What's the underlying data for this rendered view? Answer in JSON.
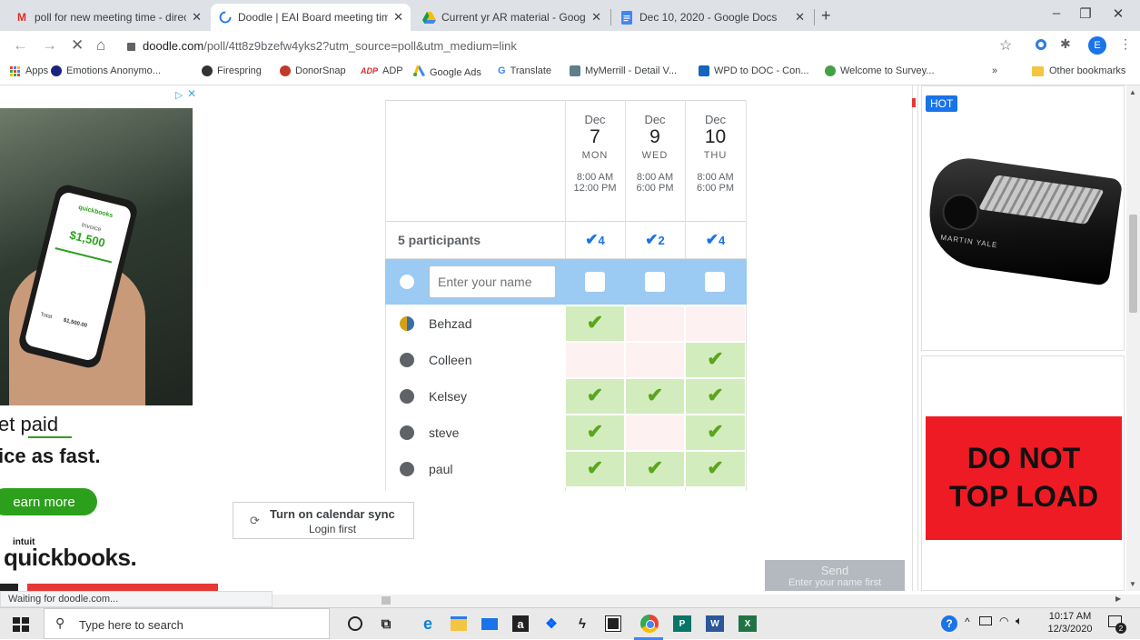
{
  "browser": {
    "tabs": [
      {
        "title": "poll for new meeting time - direc",
        "favicon": "M",
        "favicon_color": "#d93025",
        "active": false
      },
      {
        "title": "Doodle | EAI Board meeting time",
        "favicon": "○",
        "favicon_color": "#1a73e8",
        "active": true
      },
      {
        "title": "Current yr AR material - Google",
        "favicon": "▲",
        "favicon_color": "#0f9d58",
        "active": false
      },
      {
        "title": "Dec 10, 2020 - Google Docs",
        "favicon": "▤",
        "favicon_color": "#4285f4",
        "active": false
      }
    ],
    "new_tab": "+",
    "url_host": "doodle.com",
    "url_rest": "/poll/4tt8z9bzefw4yks2?utm_source=poll&utm_medium=link",
    "profile_initial": "E",
    "bookmarks": [
      {
        "label": "Apps",
        "color": "#1a73e8"
      },
      {
        "label": "Emotions Anonymo...",
        "color": "#1a237e"
      },
      {
        "label": "Firespring",
        "color": "#333333"
      },
      {
        "label": "DonorSnap",
        "color": "#c0392b"
      },
      {
        "label": "ADP",
        "color": "#d32f2f"
      },
      {
        "label": "Google Ads",
        "color": "#fbbc04"
      },
      {
        "label": "Translate",
        "color": "#4285f4"
      },
      {
        "label": "MyMerrill - Detail V...",
        "color": "#607d8b"
      },
      {
        "label": "WPD to DOC - Con...",
        "color": "#1565c0"
      },
      {
        "label": "Welcome to Survey...",
        "color": "#43a047"
      }
    ],
    "bookmarks_more": "»",
    "other_bookmarks": "Other bookmarks",
    "status_text": "Waiting for doodle.com..."
  },
  "ad_left": {
    "headline_1": "et paid",
    "headline_2": "ice as fast.",
    "cta": "earn more",
    "brand_top": "intuit",
    "brand": "quickbooks.",
    "phone_brand": "quickbooks",
    "invoice_label": "Invoice",
    "invoice_amount": "$1,500",
    "total_label": "Total",
    "total_amount": "$1,500.00"
  },
  "ad_right": {
    "badge": "HOT",
    "product_brand": "MARTIN YALE",
    "sign_line_1": "DO NOT",
    "sign_line_2": "TOP LOAD"
  },
  "poll": {
    "dates": [
      {
        "month": "Dec",
        "day": "7",
        "weekday": "MON",
        "start": "8:00 AM",
        "end": "12:00 PM",
        "count": "4"
      },
      {
        "month": "Dec",
        "day": "9",
        "weekday": "WED",
        "start": "8:00 AM",
        "end": "6:00 PM",
        "count": "2"
      },
      {
        "month": "Dec",
        "day": "10",
        "weekday": "THU",
        "start": "8:00 AM",
        "end": "6:00 PM",
        "count": "4"
      }
    ],
    "participants_label": "5 participants",
    "name_placeholder": "Enter your name",
    "participants": [
      {
        "name": "Behzad",
        "votes": [
          true,
          false,
          false
        ]
      },
      {
        "name": "Colleen",
        "votes": [
          false,
          false,
          true
        ]
      },
      {
        "name": "Kelsey",
        "votes": [
          true,
          true,
          true
        ]
      },
      {
        "name": "steve",
        "votes": [
          true,
          false,
          true
        ]
      },
      {
        "name": "paul",
        "votes": [
          true,
          true,
          true
        ]
      }
    ],
    "sync_title": "Turn on calendar sync",
    "sync_sub": "Login first",
    "send_label": "Send",
    "send_sub": "Enter your name first"
  },
  "taskbar": {
    "search_placeholder": "Type here to search",
    "time": "10:17 AM",
    "date": "12/3/2020",
    "notification_count": "2"
  },
  "colors": {
    "yes": "#d3ecbd",
    "no": "#fdf1f2",
    "check": "#5aa61d",
    "selected_row": "#9bcaf2",
    "accent": "#1a73e8"
  }
}
